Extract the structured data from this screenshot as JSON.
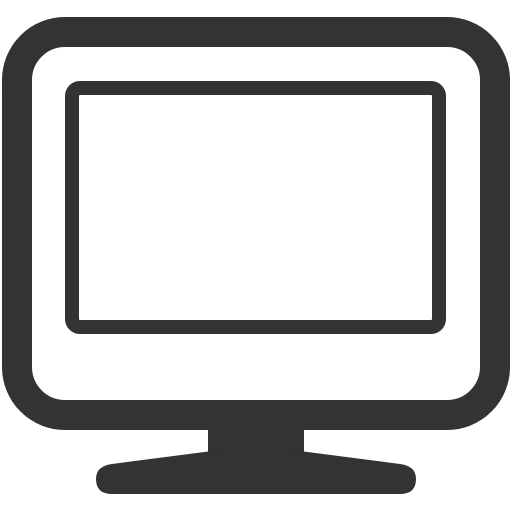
{
  "icon": {
    "name": "monitor-icon",
    "stroke_color": "#333333",
    "fill_color": "#ffffff"
  }
}
